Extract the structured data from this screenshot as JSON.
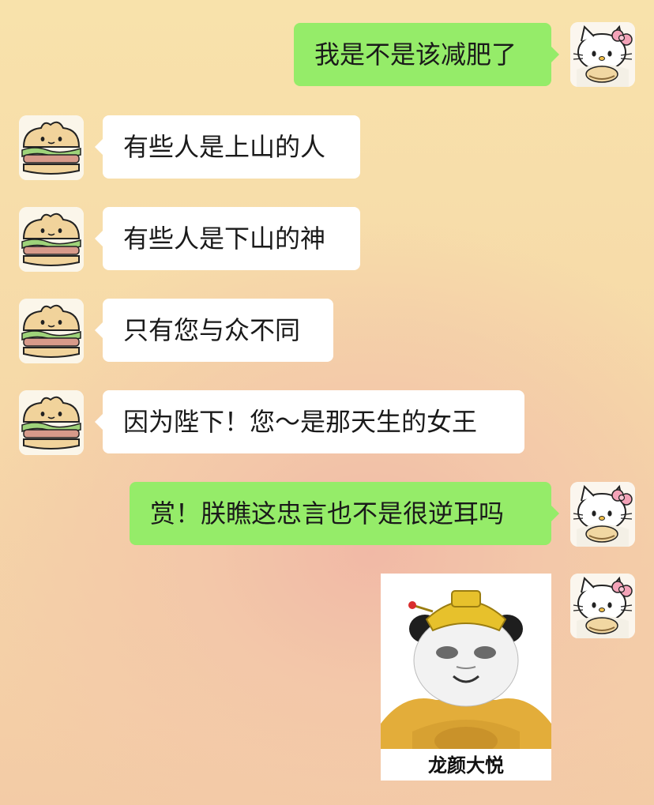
{
  "messages": [
    {
      "side": "out",
      "text": "我是不是该减肥了"
    },
    {
      "side": "in",
      "text": "有些人是上山的人"
    },
    {
      "side": "in",
      "text": "有些人是下山的神"
    },
    {
      "side": "in",
      "text": "只有您与众不同"
    },
    {
      "side": "in",
      "text": "因为陛下！您～是那天生的女王"
    },
    {
      "side": "out",
      "text": "赏！朕瞧这忠言也不是很逆耳吗"
    }
  ],
  "sticker": {
    "caption": "龙颜大悦",
    "icon": "panda-emperor-sticker"
  },
  "avatars": {
    "me": "hello-kitty-icon",
    "friend": "sandwich-bear-icon"
  },
  "colors": {
    "outgoing_bubble": "#95ec69",
    "incoming_bubble": "#ffffff"
  }
}
